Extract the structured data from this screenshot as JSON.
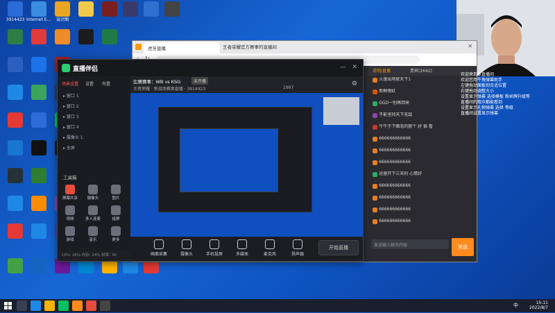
{
  "desktop": {
    "icons": [
      {
        "label": "3914423",
        "color": "#2b6cd6"
      },
      {
        "label": "Internet Explorer",
        "color": "#3a8de0"
      },
      {
        "label": "设计图",
        "color": "#e9a623"
      },
      {
        "label": "",
        "color": "#f2c94c"
      },
      {
        "label": "",
        "color": "#7a1f1f"
      },
      {
        "label": "",
        "color": "#3a3a6a"
      },
      {
        "label": "",
        "color": "#2f6fd0"
      },
      {
        "label": "",
        "color": "#444"
      },
      {
        "label": "",
        "color": "#2d7d46"
      },
      {
        "label": "",
        "color": "#e23b3b"
      },
      {
        "label": "",
        "color": "#ef8c2a"
      },
      {
        "label": "",
        "color": "#1c1c1c"
      },
      {
        "label": "",
        "color": "#1e7b45"
      },
      {
        "label": "",
        "color": "#2b5fbf"
      },
      {
        "label": "",
        "color": "#1a73e8"
      },
      {
        "label": "",
        "color": "#b71c1c"
      },
      {
        "label": "",
        "color": "#1e88e5"
      },
      {
        "label": "",
        "color": "#3ba55d"
      },
      {
        "label": "",
        "color": "#2c3e50"
      },
      {
        "label": "",
        "color": "#e53935"
      },
      {
        "label": "",
        "color": "#2b6cd6"
      },
      {
        "label": "",
        "color": "#07c160"
      },
      {
        "label": "",
        "color": "#1976d2"
      },
      {
        "label": "",
        "color": "#111"
      },
      {
        "label": "",
        "color": "#1a1a1a"
      },
      {
        "label": "",
        "color": "#263238"
      },
      {
        "label": "",
        "color": "#2e7d32"
      },
      {
        "label": "",
        "color": "#1565c0"
      },
      {
        "label": "",
        "color": "#1e88e5"
      },
      {
        "label": "",
        "color": "#fb8c00"
      },
      {
        "label": "",
        "color": "#8e44ad"
      },
      {
        "label": "",
        "color": "#e53935"
      },
      {
        "label": "",
        "color": "#1e88e5"
      },
      {
        "label": "",
        "color": "#3949ab"
      },
      {
        "label": "",
        "color": "#43a047"
      },
      {
        "label": "",
        "color": "#1565c0"
      },
      {
        "label": "",
        "color": "#6a1b9a"
      },
      {
        "label": "",
        "color": "#0288d1"
      },
      {
        "label": "",
        "color": "#ffb300"
      },
      {
        "label": "",
        "color": "#1e88e5"
      },
      {
        "label": "",
        "color": "#e53935"
      },
      {
        "label": "",
        "color": "#f57c00"
      },
      {
        "label": "",
        "color": "#ffffff"
      },
      {
        "label": "",
        "color": "#2b5fbf"
      },
      {
        "label": "",
        "color": "#ffffff"
      }
    ]
  },
  "browser": {
    "tab_title": "王者荣耀官方赛事的直播间",
    "address": "",
    "tab_label": "虎牙直播",
    "page_text": "王者荣耀官方赛事的直播间"
  },
  "chat": {
    "tabs": [
      "说明/直播",
      "贵宾(2642)"
    ],
    "messages": [
      {
        "badge": "",
        "text": "火速出场就天下1",
        "color": "#e67e22"
      },
      {
        "badge": "",
        "text": "新鲜雨虹",
        "color": "#d35400"
      },
      {
        "badge": "",
        "text": "GGD一别再回来",
        "color": "#27ae60"
      },
      {
        "badge": "",
        "text": "不能坚持天下无敌",
        "color": "#8e44ad"
      },
      {
        "badge": "",
        "text": "牛牛于下面无的那个 好 很 看",
        "color": "#c0392b"
      },
      {
        "badge": "",
        "text": "666666666666",
        "color": "#e67e22"
      },
      {
        "badge": "",
        "text": "666666666666",
        "color": "#e67e22"
      },
      {
        "badge": "",
        "text": "666666666666",
        "color": "#e67e22"
      },
      {
        "badge": "",
        "text": "运营开下三天的 心情好",
        "color": "#27ae60"
      },
      {
        "badge": "",
        "text": "666666666666",
        "color": "#e67e22"
      },
      {
        "badge": "",
        "text": "666666666666",
        "color": "#e67e22"
      },
      {
        "badge": "",
        "text": "666666666666",
        "color": "#e67e22"
      },
      {
        "badge": "",
        "text": "666666666666",
        "color": "#e67e22"
      }
    ],
    "input_placeholder": "发送输入聊天内容",
    "send_label": "发送"
  },
  "streamer": {
    "brand": "直播伴侣",
    "tabs": [
      "场景设置",
      "设置",
      "布置"
    ],
    "match_label": "比赛赛事：WB vs KSG",
    "status_label": "未开播",
    "info_line": "王者荣耀 · 新战场赛事直播 · 3914423",
    "viewers": "1997",
    "scenes": [
      "窗口 1",
      "窗口 2",
      "窗口 3",
      "窗口 4",
      "摄像头 1",
      "全屏"
    ],
    "tools_title": "工具箱",
    "apps": [
      {
        "label": "屏幕共享",
        "color": "#e74c3c"
      },
      {
        "label": "摄像头",
        "color": "#6c6f7a"
      },
      {
        "label": "图片",
        "color": "#6c6f7a"
      },
      {
        "label": "视频",
        "color": "#6c6f7a"
      },
      {
        "label": "多人连麦",
        "color": "#6c6f7a"
      },
      {
        "label": "投屏",
        "color": "#6c6f7a"
      },
      {
        "label": "游戏",
        "color": "#6c6f7a"
      },
      {
        "label": "音乐",
        "color": "#6c6f7a"
      },
      {
        "label": "更多",
        "color": "#6c6f7a"
      }
    ],
    "bottom_tools": [
      "画面采集",
      "摄像头",
      "手机投屏",
      "多媒体",
      "麦克风",
      "扬声器"
    ],
    "go_live": "开始直播",
    "footer_status": "CPU: 26%   内存: 24%   帧率: 30"
  },
  "overlay": {
    "lines": [
      "欢迎来到本直播间",
      "欢迎您用牛角弹幕助手",
      "左键拖动面板到合适位置",
      "右键拖动调整大小",
      "设置显示弹幕 选择模板 粉丝牌升级等",
      "直播间的观众都能看到",
      "设置显示礼物弹幕 选择 等级",
      "直播间设置显示弹幕"
    ]
  },
  "taskbar": {
    "time": "15:11",
    "date": "2022/8/7",
    "lang": "中"
  }
}
